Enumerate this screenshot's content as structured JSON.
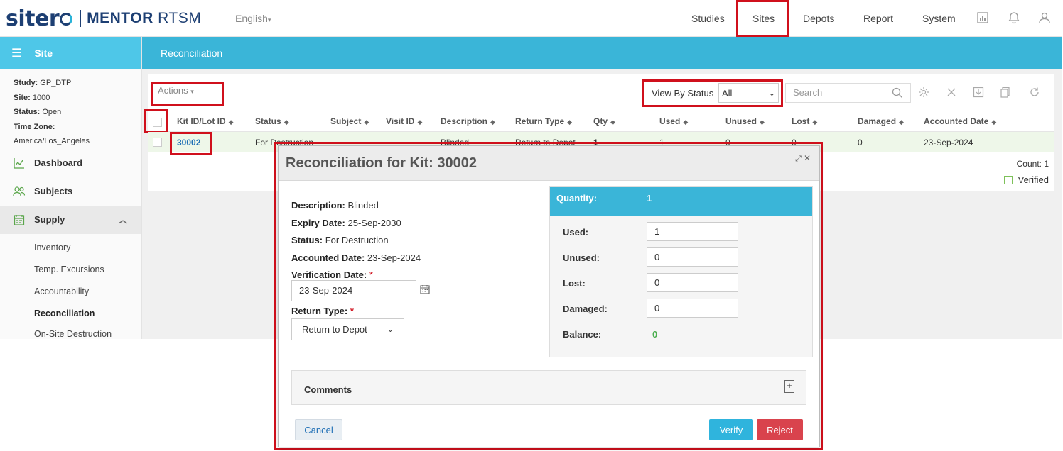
{
  "brand": {
    "name_part1": "siter",
    "name_part2": "MENTOR",
    "name_part3": "RTSM"
  },
  "language": "English",
  "nav": {
    "studies": "Studies",
    "sites": "Sites",
    "depots": "Depots",
    "report": "Report",
    "system": "System"
  },
  "sidebar": {
    "header": "Site",
    "info": {
      "study_label": "Study:",
      "study_value": "GP_DTP",
      "site_label": "Site:",
      "site_value": "1000",
      "status_label": "Status:",
      "status_value": "Open",
      "timezone_label": "Time Zone:",
      "timezone_value": "America/Los_Angeles"
    },
    "menu": {
      "dashboard": "Dashboard",
      "subjects": "Subjects",
      "supply": "Supply"
    },
    "submenu": [
      "Inventory",
      "Temp. Excursions",
      "Accountability",
      "Reconciliation",
      "On-Site Destruction"
    ]
  },
  "page": {
    "title": "Reconciliation"
  },
  "toolbar": {
    "actions": "Actions",
    "view_by_status": "View By Status",
    "status_value": "All",
    "search_placeholder": "Search"
  },
  "table": {
    "headers": [
      "Kit ID/Lot ID",
      "Status",
      "Subject",
      "Visit ID",
      "Description",
      "Return Type",
      "Qty",
      "Used",
      "Unused",
      "Lost",
      "Damaged",
      "Accounted Date"
    ],
    "row": {
      "kit_id": "30002",
      "status": "For Destruction",
      "description": "Blinded",
      "return_type": "Return to Depot",
      "qty": "1",
      "used": "1",
      "unused": "0",
      "lost": "0",
      "damaged": "0",
      "accounted_date": "23-Sep-2024"
    },
    "count": "Count: 1",
    "legend_verified": "Verified"
  },
  "modal": {
    "title": "Reconciliation for Kit: 30002",
    "description_label": "Description:",
    "description_value": "Blinded",
    "expiry_label": "Expiry Date:",
    "expiry_value": "25-Sep-2030",
    "status_label": "Status:",
    "status_value": "For Destruction",
    "accounted_label": "Accounted Date:",
    "accounted_value": "23-Sep-2024",
    "verification_label": "Verification Date:",
    "verification_value": "23-Sep-2024",
    "return_type_label": "Return Type:",
    "return_type_value": "Return to Depot",
    "quantity_label": "Quantity:",
    "quantity_value": "1",
    "used_label": "Used:",
    "used_value": "1",
    "unused_label": "Unused:",
    "unused_value": "0",
    "lost_label": "Lost:",
    "lost_value": "0",
    "damaged_label": "Damaged:",
    "damaged_value": "0",
    "balance_label": "Balance:",
    "balance_value": "0",
    "comments_label": "Comments",
    "cancel": "Cancel",
    "verify": "Verify",
    "reject": "Reject"
  },
  "colors": {
    "accent": "#3ab5d8",
    "highlight": "#d0101c",
    "verify": "#2fb4dd",
    "reject": "#d9434d",
    "balance": "#4caf50"
  }
}
